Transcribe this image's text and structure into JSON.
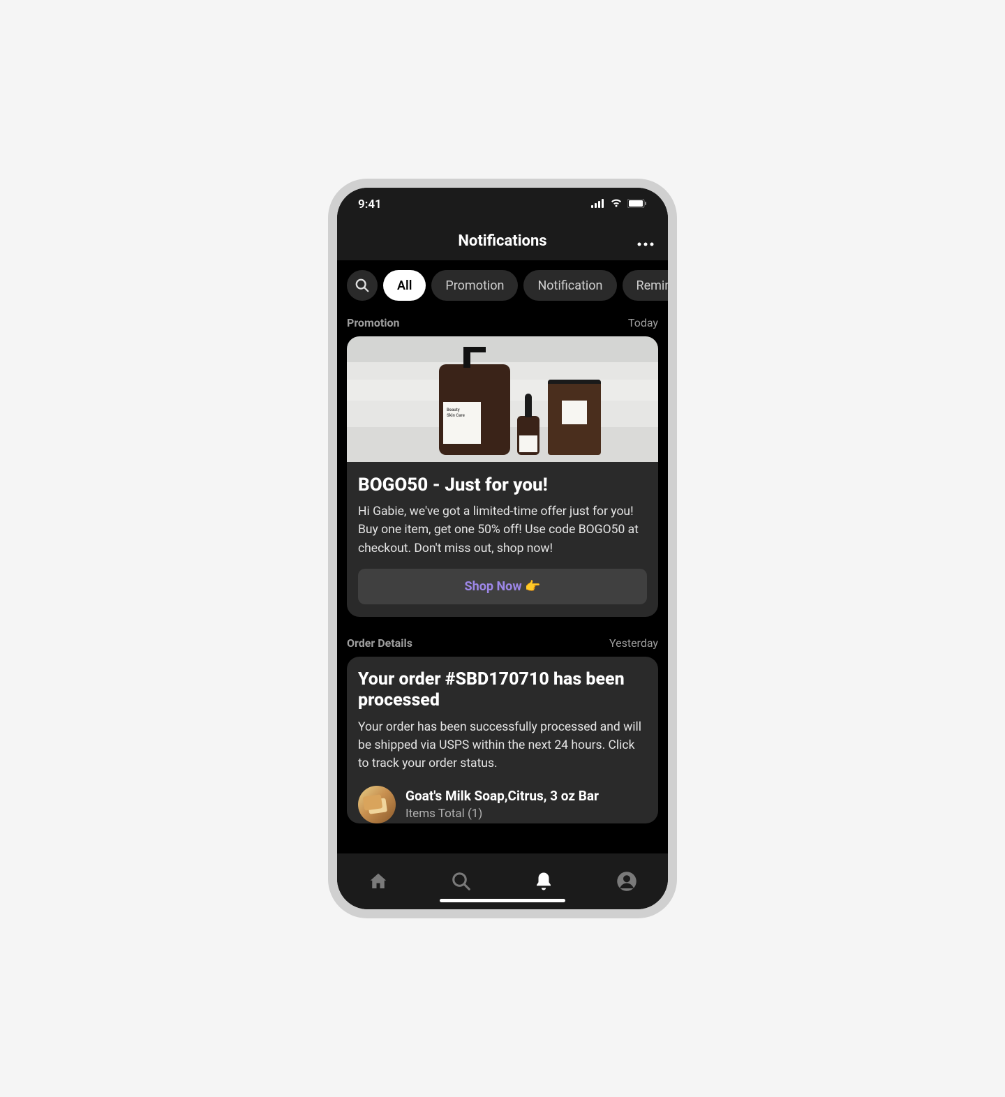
{
  "status": {
    "time": "9:41"
  },
  "header": {
    "title": "Notifications"
  },
  "filters": [
    {
      "label": "All",
      "active": true
    },
    {
      "label": "Promotion",
      "active": false
    },
    {
      "label": "Notification",
      "active": false
    },
    {
      "label": "Reminder",
      "active": false
    }
  ],
  "sections": [
    {
      "kind": "promotion",
      "label": "Promotion",
      "date": "Today",
      "card": {
        "title": "BOGO50 - Just for you!",
        "body": "Hi Gabie, we've got a limited-time offer just for you! Buy one item, get one 50% off! Use code BOGO50 at checkout. Don't miss out, shop now!",
        "cta": "Shop Now",
        "cta_emoji": "👉",
        "image_label_main": "Beauty\nSkin Care"
      }
    },
    {
      "kind": "order",
      "label": "Order Details",
      "date": "Yesterday",
      "card": {
        "title": "Your order #SBD170710 has been processed",
        "body": "Your order has been successfully processed and will be shipped via USPS within the next 24 hours. Click to track your order status.",
        "product": {
          "name": "Goat's Milk Soap,Citrus, 3 oz Bar",
          "items_total": "Items Total (1)"
        }
      }
    }
  ],
  "nav": {
    "items": [
      "home",
      "search",
      "notifications",
      "account"
    ],
    "active": "notifications"
  }
}
